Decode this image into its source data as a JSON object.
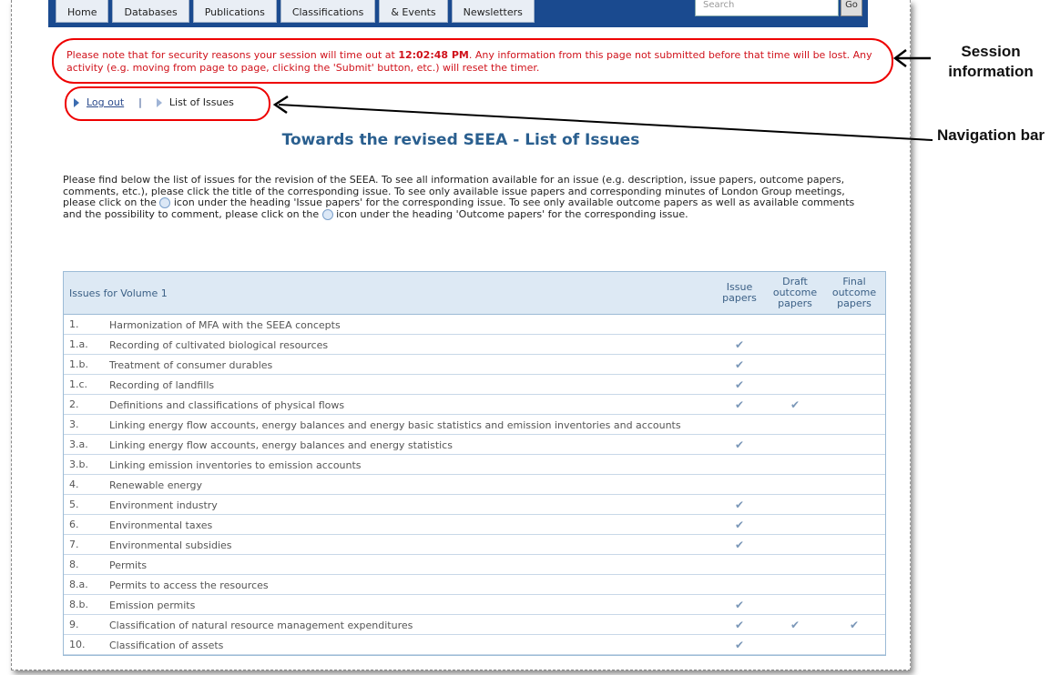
{
  "nav": {
    "tabs": [
      "Home",
      "Databases",
      "Publications",
      "Classifications",
      "& Events",
      "Newsletters"
    ],
    "search_placeholder": "Search",
    "go_label": "Go"
  },
  "session": {
    "prefix": "Please note that for security reasons your session will time out at ",
    "time": "12:02:48 PM",
    "suffix": ". Any information from this page not submitted before that time will be lost. Any activity (e.g. moving from page to page, clicking the 'Submit' button, etc.) will reset the timer."
  },
  "breadcrumb": {
    "logout": "Log out",
    "separator": "|",
    "current": "List of Issues"
  },
  "page_title": "Towards the revised SEEA - List of Issues",
  "intro": {
    "p1": "Please find below the list of issues for the revision of the SEEA. To see all information available for an issue (e.g. description, issue papers, outcome papers, comments, etc.), please click the title of the corresponding issue. To see only available issue papers and corresponding minutes of London Group meetings, please click on the ",
    "p2": " icon under the heading 'Issue papers' for the corresponding issue. To see only available outcome papers as well as available comments and the possibility to comment, please click on the ",
    "p3": " icon under the heading 'Outcome papers' for the corresponding issue."
  },
  "table": {
    "header": "Issues for Volume 1",
    "col_issue": "Issue papers",
    "col_draft": "Draft outcome papers",
    "col_final": "Final outcome papers",
    "rows": [
      {
        "num": "1.",
        "title": "Harmonization of MFA with the SEEA concepts",
        "issue": "",
        "draft": "",
        "final": ""
      },
      {
        "num": "1.a.",
        "title": "Recording of cultivated biological resources",
        "issue": "✔",
        "draft": "",
        "final": ""
      },
      {
        "num": "1.b.",
        "title": "Treatment of consumer durables",
        "issue": "✔",
        "draft": "",
        "final": ""
      },
      {
        "num": "1.c.",
        "title": "Recording of landfills",
        "issue": "✔",
        "draft": "",
        "final": ""
      },
      {
        "num": "2.",
        "title": "Definitions and classifications of physical flows",
        "issue": "✔",
        "draft": "✔",
        "final": ""
      },
      {
        "num": "3.",
        "title": "Linking energy flow accounts, energy balances and energy basic statistics and emission inventories and accounts",
        "issue": "",
        "draft": "",
        "final": ""
      },
      {
        "num": "3.a.",
        "title": "Linking energy flow accounts, energy balances and energy statistics",
        "issue": "✔",
        "draft": "",
        "final": ""
      },
      {
        "num": "3.b.",
        "title": "Linking emission inventories to emission accounts",
        "issue": "",
        "draft": "",
        "final": ""
      },
      {
        "num": "4.",
        "title": "Renewable energy",
        "issue": "",
        "draft": "",
        "final": ""
      },
      {
        "num": "5.",
        "title": "Environment industry",
        "issue": "✔",
        "draft": "",
        "final": ""
      },
      {
        "num": "6.",
        "title": "Environmental taxes",
        "issue": "✔",
        "draft": "",
        "final": ""
      },
      {
        "num": "7.",
        "title": "Environmental subsidies",
        "issue": "✔",
        "draft": "",
        "final": ""
      },
      {
        "num": "8.",
        "title": "Permits",
        "issue": "",
        "draft": "",
        "final": ""
      },
      {
        "num": "8.a.",
        "title": "Permits to access the resources",
        "issue": "",
        "draft": "",
        "final": ""
      },
      {
        "num": "8.b.",
        "title": "Emission permits",
        "issue": "✔",
        "draft": "",
        "final": ""
      },
      {
        "num": "9.",
        "title": "Classification of natural resource management expenditures",
        "issue": "✔",
        "draft": "✔",
        "final": "✔"
      },
      {
        "num": "10.",
        "title": "Classification of assets",
        "issue": "✔",
        "draft": "",
        "final": ""
      }
    ]
  },
  "annotations": {
    "session": "Session information",
    "navigation": "Navigation bar"
  },
  "colors": {
    "nav_bg": "#1a4a8f",
    "alert_red": "#d0121b",
    "title_blue": "#2a5f8f"
  }
}
